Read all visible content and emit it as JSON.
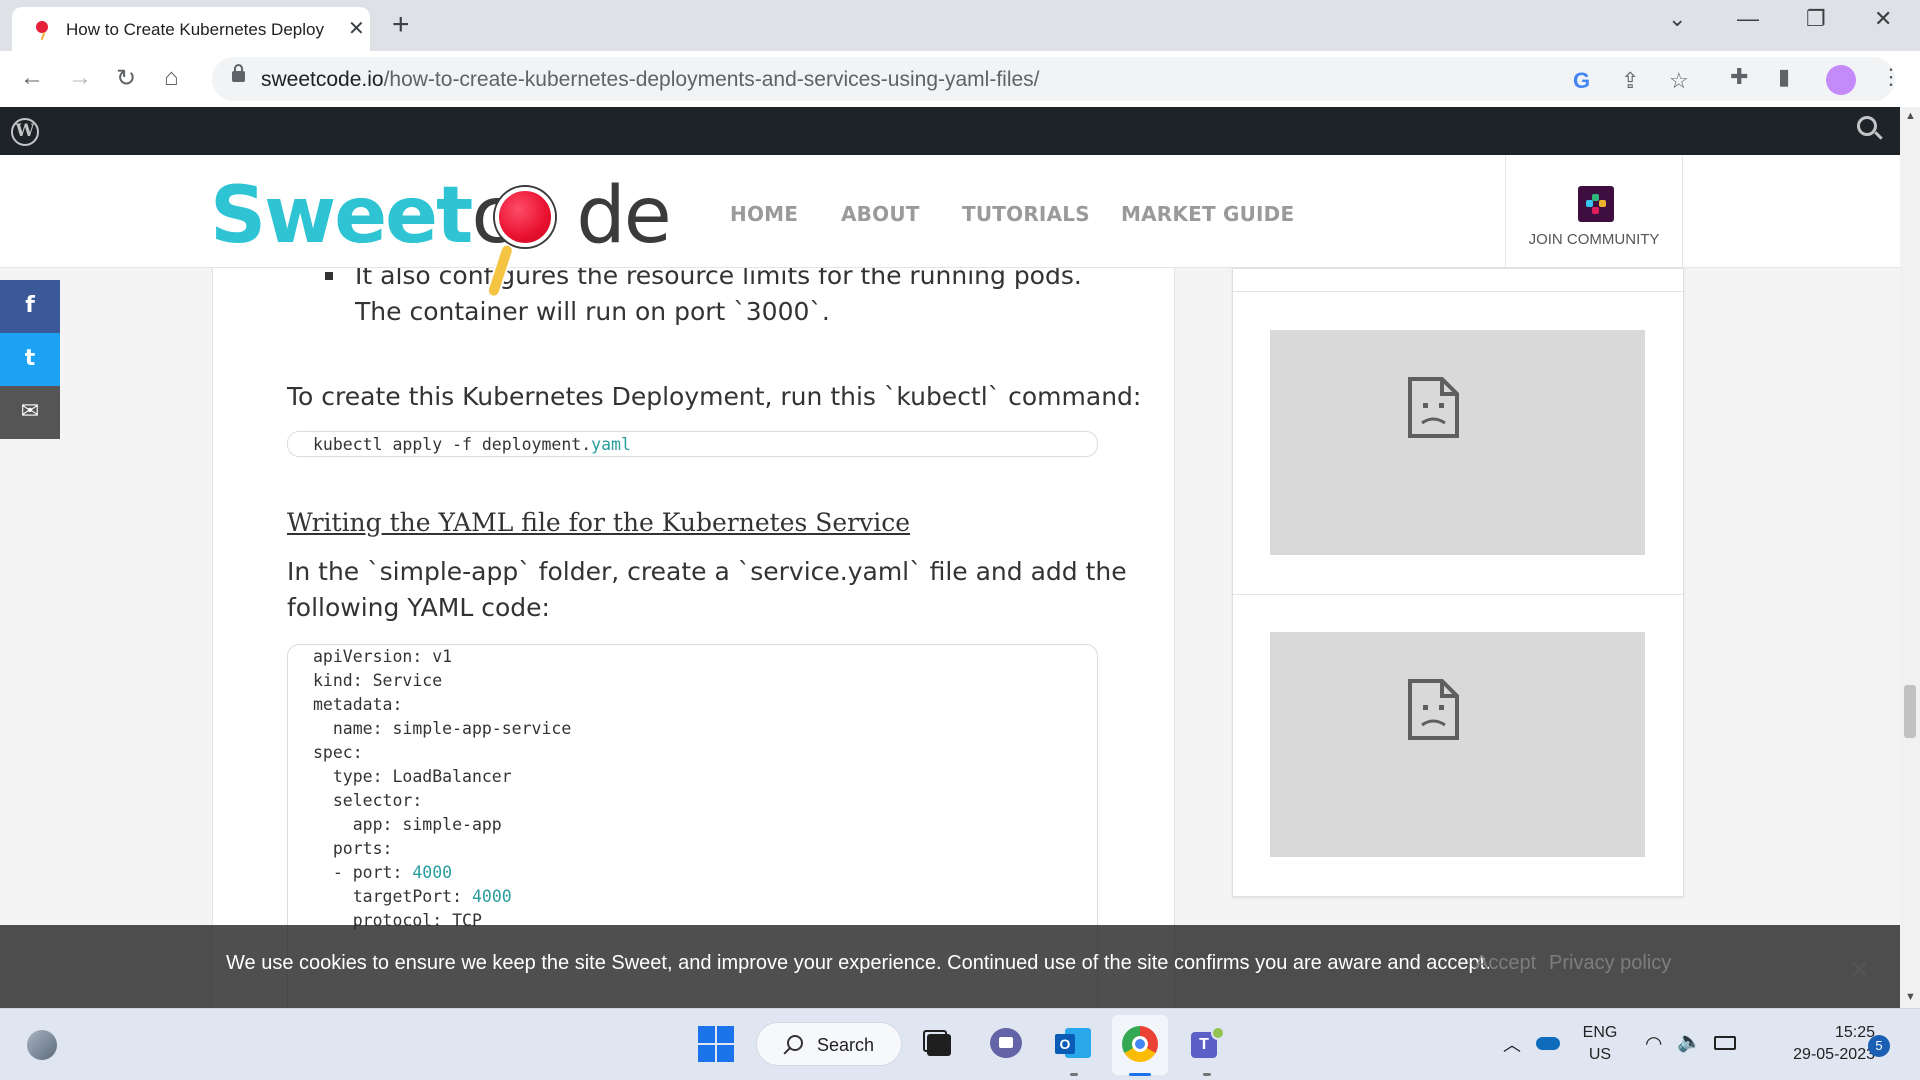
{
  "browser": {
    "tab_title": "How to Create Kubernetes Deploy",
    "tab_close": "✕",
    "new_tab": "+",
    "url_host": "sweetcode.io",
    "url_path": "/how-to-create-kubernetes-deployments-and-services-using-yaml-files/"
  },
  "header": {
    "logo_sweet": "Sweet",
    "logo_c": "c",
    "logo_de": "de",
    "nav": [
      "HOME",
      "ABOUT",
      "TUTORIALS",
      "MARKET GUIDE"
    ],
    "community_label": "JOIN COMMUNITY"
  },
  "article": {
    "bullet_line1": "It also configures the resource limits for the running pods.",
    "bullet_line2": "The container will run on port `3000`.",
    "deploy_intro": "To create this Kubernetes Deployment, run this `kubectl` command:",
    "deploy_cmd_plain": "kubectl apply -f deployment.",
    "deploy_cmd_ext": "yaml",
    "service_heading": "Writing the YAML file for the Kubernetes Service",
    "service_intro_1": "In the `simple-app` folder, create a `service.yaml` file and add the",
    "service_intro_2": "following YAML code:",
    "code_lines": [
      "apiVersion: v1",
      "kind: Service",
      "metadata:",
      "  name: simple-app-service",
      "spec:",
      "  type: LoadBalancer",
      "  selector:",
      "    app: simple-app",
      "  ports:",
      "  - port: ",
      "    targetPort: ",
      "    protocol: TCP"
    ],
    "port_value": "4000",
    "target_port_value": "4000"
  },
  "social": {
    "facebook": "f",
    "twitter": "t",
    "email": "✉"
  },
  "cookie": {
    "message": "We use cookies to ensure we keep the site Sweet, and improve your experience. Continued use of the site confirms you are aware and accept.",
    "accept": "Accept",
    "privacy": "Privacy policy",
    "close": "✕"
  },
  "taskbar": {
    "search_label": "Search",
    "lang_top": "ENG",
    "lang_bottom": "US",
    "time": "15:25",
    "date": "29-05-2023",
    "notif_count": "5"
  },
  "colors": {
    "brand_cyan": "#2ec4d4",
    "brand_red": "#e8102f",
    "facebook": "#3b5998",
    "twitter": "#1da1f2",
    "email": "#555555",
    "code_number": "#2a9d9f"
  }
}
